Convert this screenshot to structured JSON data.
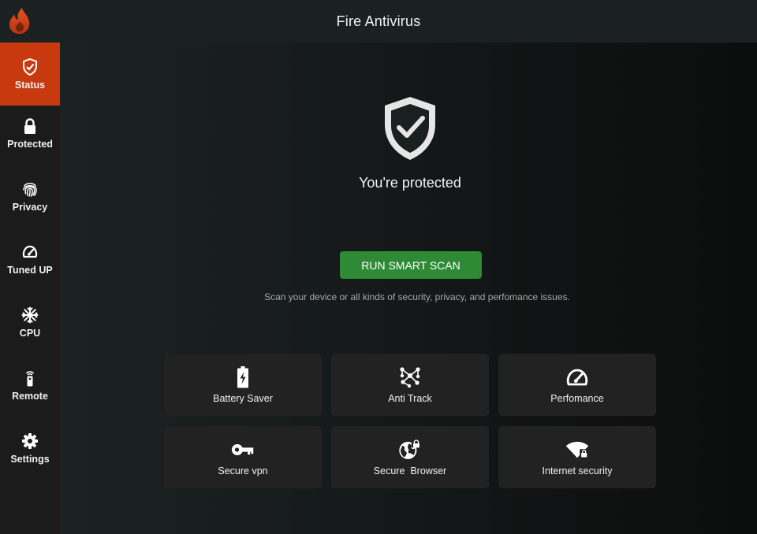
{
  "app": {
    "title": "Fire Antivirus"
  },
  "sidebar": {
    "items": [
      {
        "label": "Status",
        "icon": "shield-check-icon",
        "active": true
      },
      {
        "label": "Protected",
        "icon": "lock-icon"
      },
      {
        "label": "Privacy",
        "icon": "fingerprint-icon"
      },
      {
        "label": "Tuned UP",
        "icon": "speedometer-icon"
      },
      {
        "label": "CPU",
        "icon": "snowflake-icon"
      },
      {
        "label": "Remote",
        "icon": "remote-icon"
      },
      {
        "label": "Settings",
        "icon": "gear-icon"
      }
    ]
  },
  "main": {
    "status_text": "You're protected",
    "scan_button": "RUN SMART SCAN",
    "scan_description": "Scan your device or all kinds of security, privacy, and perfomance issues.",
    "tiles": [
      {
        "label": "Battery Saver",
        "icon": "battery-icon"
      },
      {
        "label": "Anti Track",
        "icon": "network-nodes-icon"
      },
      {
        "label": "Perfomance",
        "icon": "speedometer-icon"
      },
      {
        "label": "Secure vpn",
        "icon": "key-icon"
      },
      {
        "label": "Secure  Browser",
        "icon": "globe-lock-icon"
      },
      {
        "label": "Internet security",
        "icon": "wifi-lock-icon"
      }
    ]
  },
  "colors": {
    "accent": "#c8390f",
    "scan_button": "#2f8a35",
    "topbar": "#1b2121",
    "sidebar": "#1b1b1b",
    "tile": "#222222"
  }
}
